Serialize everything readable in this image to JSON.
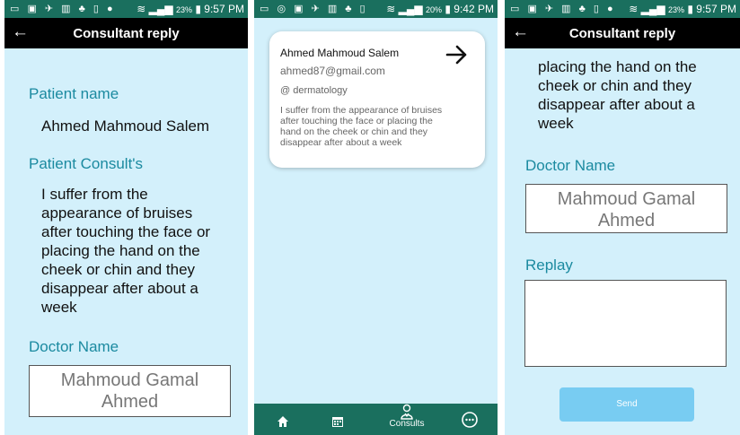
{
  "panel1": {
    "status": {
      "time": "9:57 PM",
      "battery": "23%"
    },
    "appbar": {
      "back_icon": "arrow-back-icon",
      "title": "Consultant reply"
    },
    "patient_name_label": "Patient name",
    "patient_name": "Ahmed Mahmoud Salem",
    "consult_label": "Patient Consult's",
    "consult_lines": [
      "I suffer from the",
      "appearance of bruises",
      "after touching the face or",
      "placing the hand on the",
      "cheek or chin and they",
      "disappear after about a",
      "week"
    ],
    "doctor_label": "Doctor Name",
    "doctor_lines": [
      "Mahmoud Gamal",
      "Ahmed"
    ]
  },
  "panel2": {
    "status": {
      "time": "9:42 PM",
      "battery": "20%"
    },
    "card": {
      "name": "Ahmed Mahmoud Salem",
      "email": "ahmed87@gmail.com",
      "specialty": "@ dermatology",
      "body_lines": [
        "I suffer from the appearance of bruises",
        "after touching the face or placing the",
        "hand on the cheek or chin and they",
        "disappear after about a week"
      ],
      "open_icon": "arrow-right-icon"
    },
    "bottom_nav": {
      "home_icon": "home-icon",
      "calendar_icon": "calendar-icon",
      "consults_icon": "doctor-icon",
      "consults_label": "Consults",
      "more_icon": "more-icon"
    }
  },
  "panel3": {
    "status": {
      "time": "9:57 PM",
      "battery": "23%"
    },
    "appbar": {
      "back_icon": "arrow-back-icon",
      "title": "Consultant reply"
    },
    "consult_lines": [
      "placing the hand on the",
      "cheek or chin and they",
      "disappear after about a",
      "week"
    ],
    "doctor_label": "Doctor Name",
    "doctor_lines": [
      "Mahmoud Gamal",
      "Ahmed"
    ],
    "reply_label": "Replay",
    "reply_value": "",
    "send_label": "Send"
  },
  "colors": {
    "status_bar": "#1a6f5e",
    "background": "#d3f0fb",
    "label": "#1b8aa0",
    "send_button": "#78ccf2"
  }
}
